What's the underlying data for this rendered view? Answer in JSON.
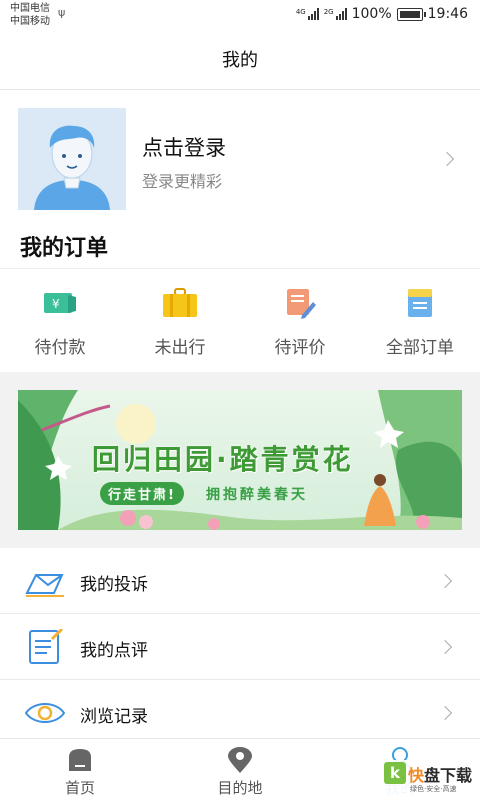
{
  "status_bar": {
    "carrier1": "中国电信",
    "carrier2": "中国移动",
    "net1": "4G",
    "net2": "2G",
    "battery": "100%",
    "time": "19:46"
  },
  "header": {
    "title": "我的"
  },
  "profile": {
    "title": "点击登录",
    "subtitle": "登录更精彩"
  },
  "orders": {
    "title": "我的订单",
    "items": [
      {
        "label": "待付款",
        "icon": "payment-pending-icon"
      },
      {
        "label": "未出行",
        "icon": "suitcase-icon"
      },
      {
        "label": "待评价",
        "icon": "review-pencil-icon"
      },
      {
        "label": "全部订单",
        "icon": "all-orders-icon"
      }
    ]
  },
  "banner": {
    "title": "回归田园·踏青赏花",
    "pill": "行走甘肃!",
    "subtitle": "拥抱醉美春天"
  },
  "menu": [
    {
      "label": "我的投诉",
      "icon": "complaint-icon"
    },
    {
      "label": "我的点评",
      "icon": "comment-icon"
    },
    {
      "label": "浏览记录",
      "icon": "eye-icon"
    }
  ],
  "tabbar": {
    "tabs": [
      {
        "label": "首页",
        "icon": "home-icon"
      },
      {
        "label": "目的地",
        "icon": "location-pin-icon"
      },
      {
        "label": "我的",
        "icon": "person-icon"
      }
    ]
  },
  "watermark": {
    "letter": "k",
    "name_a": "快",
    "name_b": "盘下载",
    "tagline": "绿色·安全·高速"
  },
  "colors": {
    "accent_green": "#3d9a34",
    "tab_active": "#3a9ee0",
    "divider": "#eaeaea"
  }
}
